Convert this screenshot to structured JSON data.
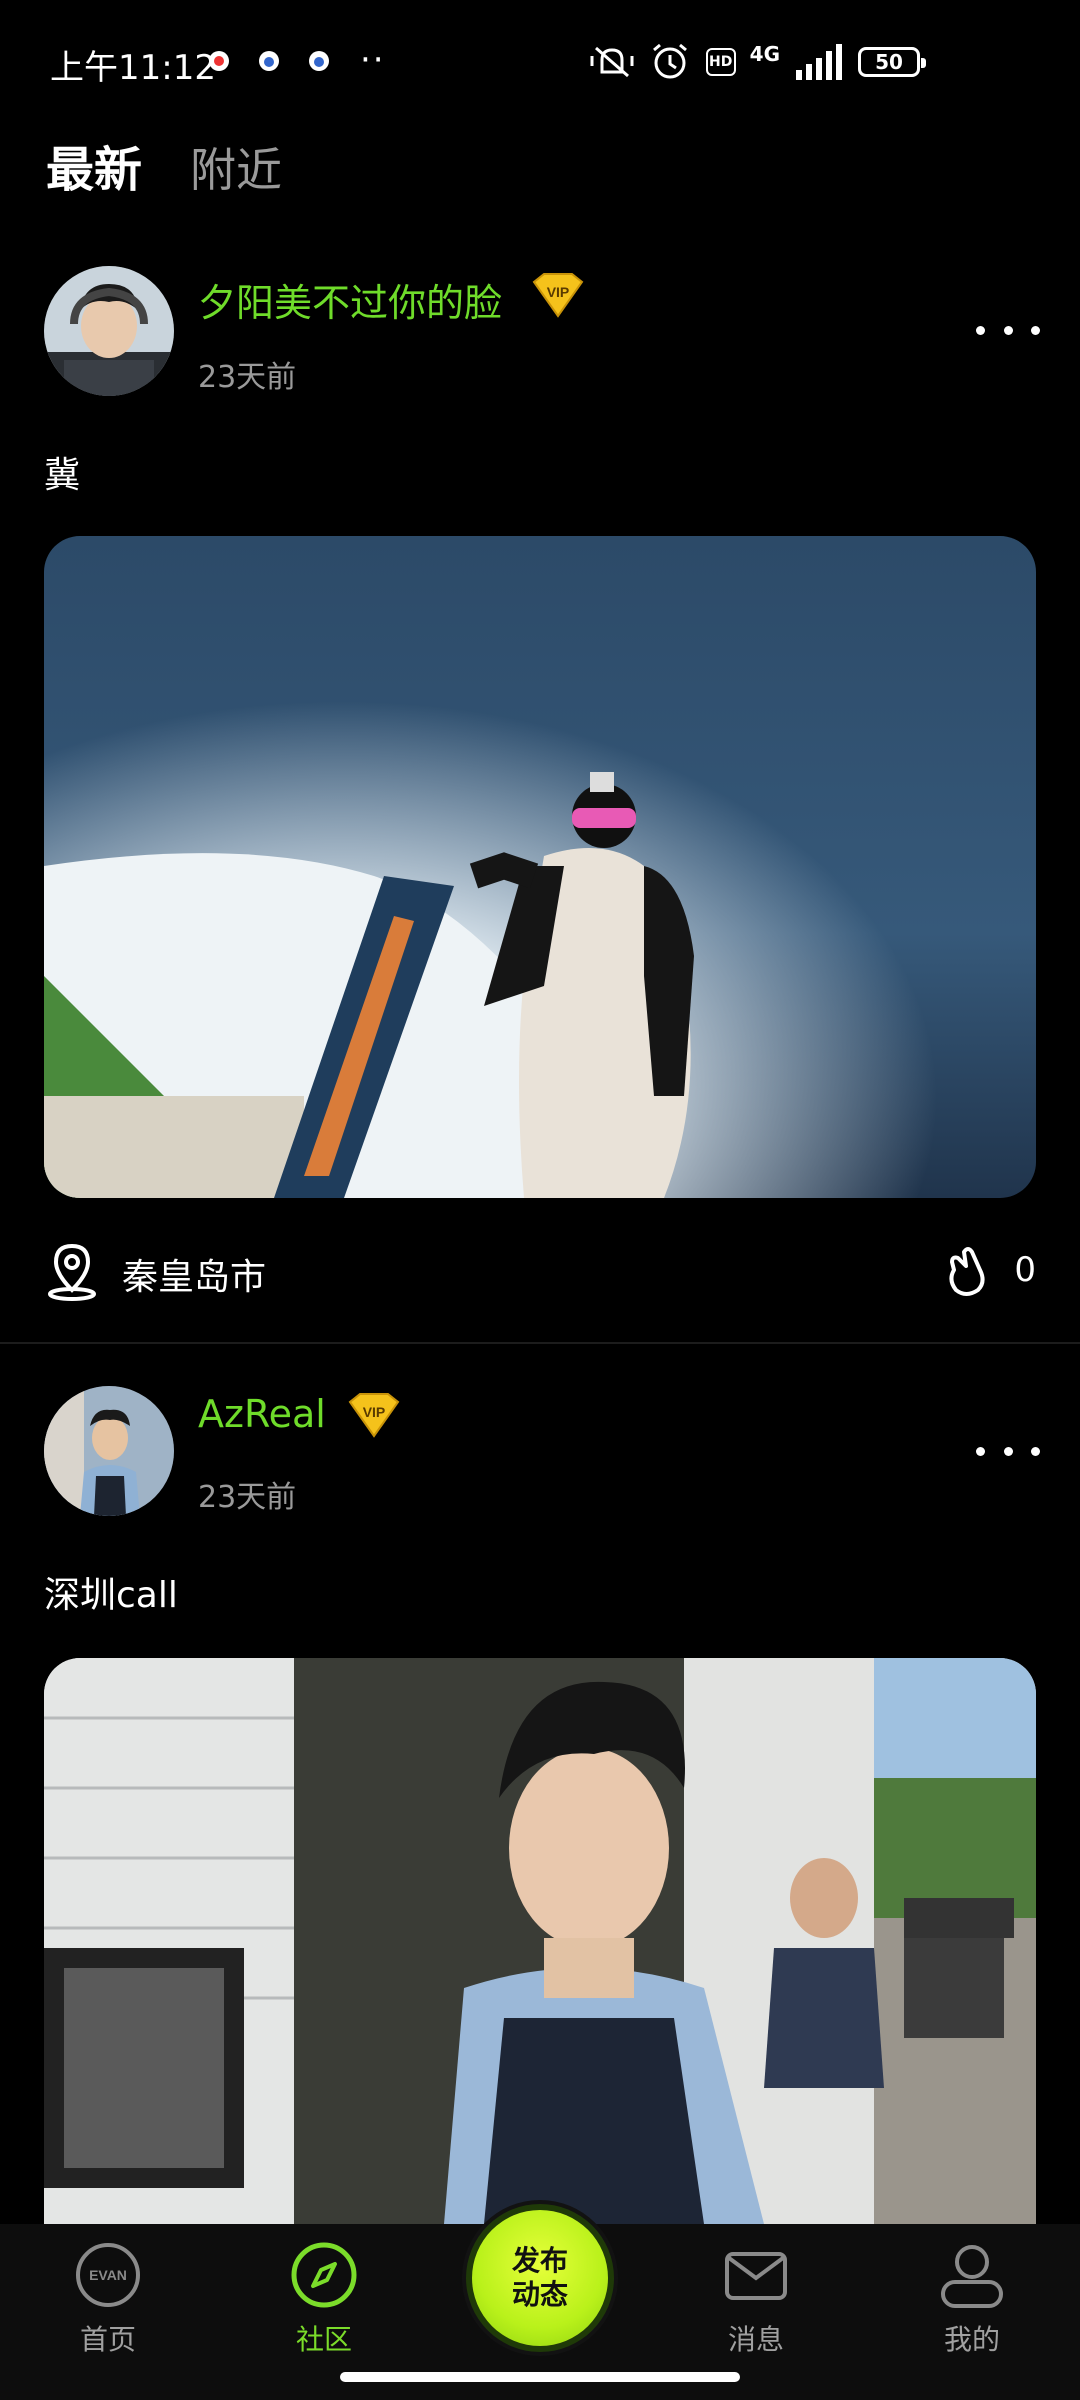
{
  "status_bar": {
    "time": "上午11:12",
    "dots": "··",
    "network": "4G",
    "hd": "HD",
    "battery": "50"
  },
  "tabs": [
    {
      "label": "最新",
      "active": true
    },
    {
      "label": "附近",
      "active": false
    }
  ],
  "posts": [
    {
      "username": "夕阳美不过你的脸",
      "vip": "VIP",
      "time_ago": "23天前",
      "content": "冀",
      "location": "秦皇岛市",
      "likes": "0"
    },
    {
      "username": "AzReal",
      "vip": "VIP",
      "time_ago": "23天前",
      "content": "深圳call"
    }
  ],
  "bottom_nav": {
    "home": "首页",
    "community": "社区",
    "publish_line1": "发布",
    "publish_line2": "动态",
    "messages": "消息",
    "mine": "我的",
    "home_logo_text": "EVAN"
  },
  "colors": {
    "accent_green": "#6fdc2a",
    "publish_yellow_green": "#c8f51f",
    "background": "#000000"
  }
}
